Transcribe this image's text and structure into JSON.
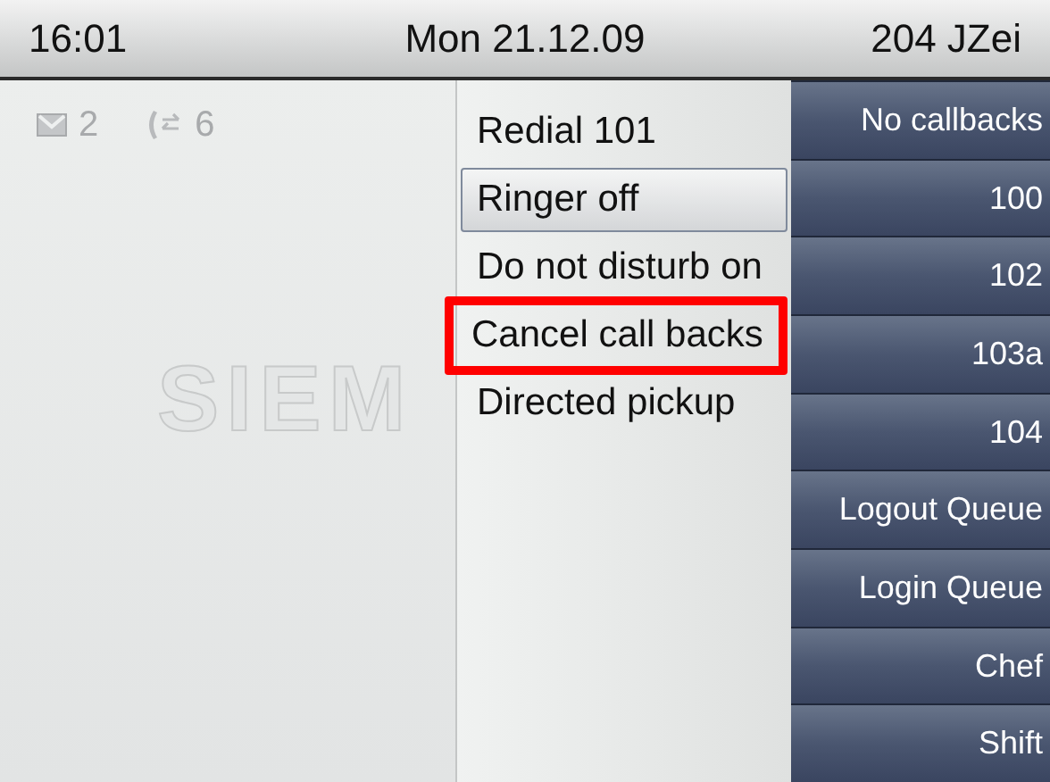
{
  "status_bar": {
    "time": "16:01",
    "date": "Mon 21.12.09",
    "user": "204 JZei"
  },
  "counters": [
    {
      "kind": "mail",
      "count": "2"
    },
    {
      "kind": "calls",
      "count": "6"
    }
  ],
  "logo": "SIEM",
  "menu": [
    {
      "label": "Redial 101",
      "selected": false,
      "annotated": false
    },
    {
      "label": "Ringer off",
      "selected": true,
      "annotated": false
    },
    {
      "label": "Do not disturb on",
      "selected": false,
      "annotated": false
    },
    {
      "label": "Cancel call backs",
      "selected": false,
      "annotated": true
    },
    {
      "label": "Directed pickup",
      "selected": false,
      "annotated": false
    }
  ],
  "keys": [
    "No callbacks",
    "100",
    "102",
    "103a",
    "104",
    "Logout Queue",
    "Login Queue",
    "Chef",
    "Shift"
  ]
}
